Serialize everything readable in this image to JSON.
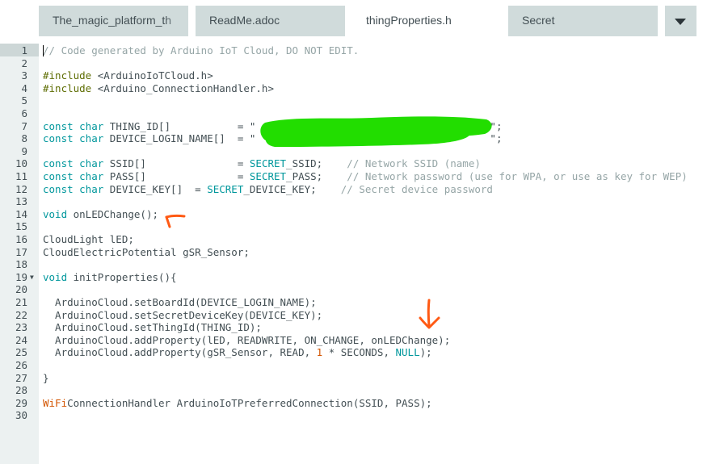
{
  "tabs": [
    {
      "label": "The_magic_platform_th",
      "active": false
    },
    {
      "label": "ReadMe.adoc",
      "active": false
    },
    {
      "label": "thingProperties.h",
      "active": true
    },
    {
      "label": "Secret",
      "active": false
    }
  ],
  "tab_menu_icon": "chevron-down-icon",
  "colors": {
    "keyword": "#00979c",
    "preprocessor": "#5e6d03",
    "comment": "#95a5a6",
    "type": "#d35400",
    "redaction": "#22dd00",
    "annotation_arrow": "#ff5a14"
  },
  "lines": [
    {
      "n": "1"
    },
    {
      "n": "2"
    },
    {
      "n": "3"
    },
    {
      "n": "4"
    },
    {
      "n": "5"
    },
    {
      "n": "6"
    },
    {
      "n": "7"
    },
    {
      "n": "8"
    },
    {
      "n": "9"
    },
    {
      "n": "10"
    },
    {
      "n": "11"
    },
    {
      "n": "12"
    },
    {
      "n": "13"
    },
    {
      "n": "14"
    },
    {
      "n": "15"
    },
    {
      "n": "16"
    },
    {
      "n": "17"
    },
    {
      "n": "18"
    },
    {
      "n": "19"
    },
    {
      "n": "20"
    },
    {
      "n": "21"
    },
    {
      "n": "22"
    },
    {
      "n": "23"
    },
    {
      "n": "24"
    },
    {
      "n": "25"
    },
    {
      "n": "26"
    },
    {
      "n": "27"
    },
    {
      "n": "28"
    },
    {
      "n": "29"
    },
    {
      "n": "30"
    }
  ],
  "code": {
    "l1": "// Code generated by Arduino IoT Cloud, DO NOT EDIT.",
    "l3_kw": "#include",
    "l3_rest": " <ArduinoIoTCloud.h>",
    "l4_kw": "#include",
    "l4_rest": " <Arduino_ConnectionHandler.h>",
    "l7_kw": "const char",
    "l7_rest": " THING_ID[]           = \"",
    "l7_end": "\";",
    "l8_kw": "const char",
    "l8_rest": " DEVICE_LOGIN_NAME[]  = \"",
    "l8_end": "\";",
    "l10_kw": "const char",
    "l10_mid": " SSID[]               = ",
    "l10_sec": "SECRET",
    "l10_end": "_SSID;",
    "l10_cm": "    // Network SSID (name)",
    "l11_kw": "const char",
    "l11_mid": " PASS[]               = ",
    "l11_sec": "SECRET",
    "l11_end": "_PASS;",
    "l11_cm": "    // Network password (use for WPA, or use as key for WEP)",
    "l12_kw": "const char",
    "l12_mid": " DEVICE_KEY[]  = ",
    "l12_sec": "SECRET",
    "l12_end": "_DEVICE_KEY;",
    "l12_cm": "    // Secret device password",
    "l14_kw": "void",
    "l14_rest": " onLEDChange();",
    "l16": "CloudLight lED;",
    "l17": "CloudElectricPotential gSR_Sensor;",
    "l19_kw": "void",
    "l19_rest": " initProperties(){",
    "l21": "  ArduinoCloud.setBoardId(DEVICE_LOGIN_NAME);",
    "l22": "  ArduinoCloud.setSecretDeviceKey(DEVICE_KEY);",
    "l23": "  ArduinoCloud.setThingId(THING_ID);",
    "l24": "  ArduinoCloud.addProperty(lED, READWRITE, ON_CHANGE, onLEDChange);",
    "l25_a": "  ArduinoCloud.addProperty(gSR_Sensor, READ, ",
    "l25_num": "1",
    "l25_b": " * SECONDS, ",
    "l25_null": "NULL",
    "l25_c": ");",
    "l27": "}",
    "l29_ty": "WiFi",
    "l29_rest": "ConnectionHandler ArduinoIoTPreferredConnection(SSID, PASS);"
  }
}
